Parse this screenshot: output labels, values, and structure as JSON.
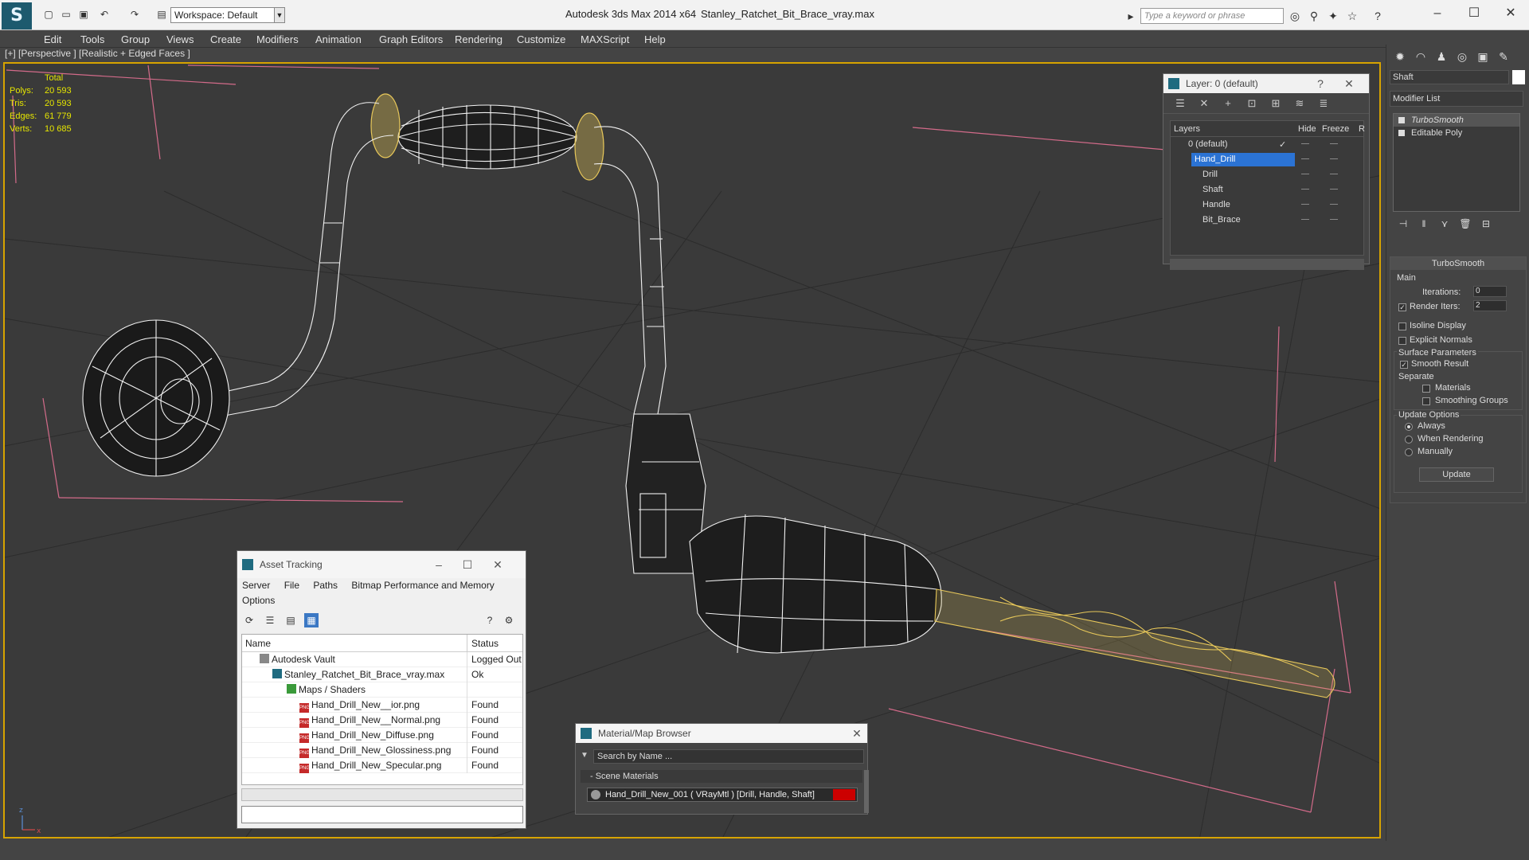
{
  "titlebar": {
    "logo_label": "S",
    "workspace": "Workspace: Default",
    "app_title": "Autodesk 3ds Max  2014 x64",
    "doc_title": "Stanley_Ratchet_Bit_Brace_vray.max",
    "search_placeholder": "Type a keyword or phrase"
  },
  "menu": [
    "Edit",
    "Tools",
    "Group",
    "Views",
    "Create",
    "Modifiers",
    "Animation",
    "Graph Editors",
    "Rendering",
    "Customize",
    "MAXScript",
    "Help"
  ],
  "viewport": {
    "label": "[+] [Perspective ] [Realistic + Edged Faces ]",
    "stats": {
      "total_label": "Total",
      "rows": [
        {
          "label": "Polys:",
          "value": "20 593"
        },
        {
          "label": "Tris:",
          "value": "20 593"
        },
        {
          "label": "Edges:",
          "value": "61 779"
        },
        {
          "label": "Verts:",
          "value": "10 685"
        }
      ]
    },
    "axis_z": "z",
    "axis_x": "x"
  },
  "layer_panel": {
    "title": "Layer: 0 (default)",
    "help": "?",
    "close": "✕",
    "headers": {
      "layers": "Layers",
      "hide": "Hide",
      "freeze": "Freeze",
      "r": "R"
    },
    "rows": [
      {
        "name": "0 (default)",
        "indent": 1,
        "check": "✓"
      },
      {
        "name": "Hand_Drill",
        "indent": 1,
        "selected": true
      },
      {
        "name": "Drill",
        "indent": 2
      },
      {
        "name": "Shaft",
        "indent": 2
      },
      {
        "name": "Handle",
        "indent": 2
      },
      {
        "name": "Bit_Brace",
        "indent": 2
      }
    ]
  },
  "command_panel": {
    "object_name": "Shaft",
    "modifier_list": "Modifier List",
    "stack": [
      {
        "name": "TurboSmooth",
        "selected": true
      },
      {
        "name": "Editable Poly",
        "selected": false
      }
    ],
    "turbosmooth": {
      "title": "TurboSmooth",
      "main": "Main",
      "iterations_label": "Iterations:",
      "iterations_value": "0",
      "render_iters_label": "Render Iters:",
      "render_iters_value": "2",
      "isoline": "Isoline Display",
      "explicit_normals": "Explicit Normals",
      "surface_params": "Surface Parameters",
      "smooth_result": "Smooth Result",
      "separate": "Separate",
      "materials": "Materials",
      "smoothing_groups": "Smoothing Groups",
      "update_options": "Update Options",
      "always": "Always",
      "when_rendering": "When Rendering",
      "manually": "Manually",
      "update_btn": "Update"
    }
  },
  "asset_tracking": {
    "title": "Asset Tracking",
    "menu": [
      "Server",
      "File",
      "Paths",
      "Bitmap Performance and Memory"
    ],
    "menu2": "Options",
    "headers": {
      "name": "Name",
      "status": "Status"
    },
    "rows": [
      {
        "name": "Autodesk Vault",
        "status": "Logged Out",
        "indent": 0,
        "icon": "vault"
      },
      {
        "name": "Stanley_Ratchet_Bit_Brace_vray.max",
        "status": "Ok",
        "indent": 1,
        "icon": "max"
      },
      {
        "name": "Maps / Shaders",
        "status": "",
        "indent": 2,
        "icon": "folder"
      },
      {
        "name": "Hand_Drill_New__ior.png",
        "status": "Found",
        "indent": 3,
        "icon": "png"
      },
      {
        "name": "Hand_Drill_New__Normal.png",
        "status": "Found",
        "indent": 3,
        "icon": "png"
      },
      {
        "name": "Hand_Drill_New_Diffuse.png",
        "status": "Found",
        "indent": 3,
        "icon": "png"
      },
      {
        "name": "Hand_Drill_New_Glossiness.png",
        "status": "Found",
        "indent": 3,
        "icon": "png"
      },
      {
        "name": "Hand_Drill_New_Specular.png",
        "status": "Found",
        "indent": 3,
        "icon": "png"
      }
    ],
    "png_tag": "PNG"
  },
  "material_browser": {
    "title": "Material/Map Browser",
    "search": "Search by Name ...",
    "section": "- Scene Materials",
    "item": "Hand_Drill_New_001  ( VRayMtl )  [Drill, Handle, Shaft]"
  },
  "colors": {
    "accent": "#d7a300",
    "selection": "#2b73d4",
    "stats": "#e6e600",
    "wire": "#f2f2f2",
    "wire_yellow": "#e8c85a"
  }
}
